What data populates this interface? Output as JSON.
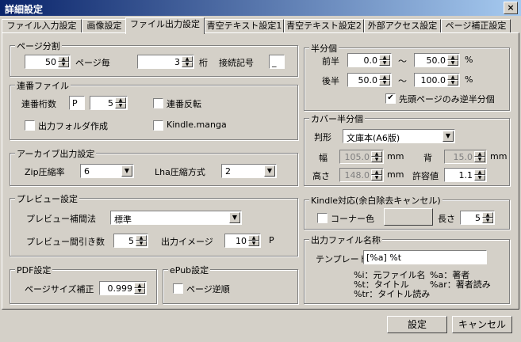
{
  "window": {
    "title": "詳細設定",
    "close_glyph": "×"
  },
  "tabs": [
    {
      "label": "ファイル入力設定"
    },
    {
      "label": "画像設定"
    },
    {
      "label": "ファイル出力設定"
    },
    {
      "label": "青空テキスト設定1"
    },
    {
      "label": "青空テキスト設定2"
    },
    {
      "label": "外部アクセス設定"
    },
    {
      "label": "ページ補正設定"
    }
  ],
  "active_tab": "ファイル出力設定",
  "page_split": {
    "legend": "ページ分割",
    "pages_value": "50",
    "pages_label": "ページ毎",
    "digits_value": "3",
    "digits_label": "桁",
    "suffix_label": "接続記号",
    "suffix_value": "_"
  },
  "serial": {
    "legend": "連番ファイル",
    "digits_label": "連番桁数",
    "prefix_value": "P",
    "digits_value": "5",
    "reverse_label": "連番反転",
    "reverse_checked": false,
    "folder_label": "出力フォルダ作成",
    "folder_checked": false,
    "kindle_label": "Kindle.manga",
    "kindle_checked": false
  },
  "archive": {
    "legend": "アーカイブ出力設定",
    "zip_label": "Zip圧縮率",
    "zip_value": "6",
    "lha_label": "Lha圧縮方式",
    "lha_value": "2"
  },
  "preview": {
    "legend": "プレビュー設定",
    "interp_label": "プレビュー補間法",
    "interp_value": "標準",
    "skip_label": "プレビュー間引き数",
    "skip_value": "5",
    "image_label": "出力イメージ",
    "image_value": "10",
    "image_unit": "P"
  },
  "pdf": {
    "legend": "PDF設定",
    "size_label": "ページサイズ補正",
    "size_value": "0.999"
  },
  "epub": {
    "legend": "ePub設定",
    "reverse_label": "ページ逆順",
    "reverse_checked": false
  },
  "half": {
    "legend": "半分個",
    "first_label": "前半",
    "first_from": "0.0",
    "first_to": "50.0",
    "second_label": "後半",
    "second_from": "50.0",
    "second_to": "100.0",
    "tilde": "～",
    "percent": "%",
    "head_only_label": "先頭ページのみ逆半分個",
    "head_only_checked": true
  },
  "cover": {
    "legend": "カバー半分個",
    "size_label": "判形",
    "size_value": "文庫本(A6版)",
    "width_label": "幅",
    "width_value": "105.0",
    "mm": "mm",
    "spine_label": "背",
    "spine_value": "15.0",
    "height_label": "高さ",
    "height_value": "148.0",
    "tol_label": "許容値",
    "tol_value": "1.1"
  },
  "kindle": {
    "legend": "Kindle対応(余白除去キャンセル)",
    "corner_label": "コーナー色",
    "corner_checked": false,
    "corner_color": "#d4d0c8",
    "length_label": "長さ",
    "length_value": "5"
  },
  "outname": {
    "legend": "出力ファイル名称",
    "template_label": "テンプレート",
    "template_value": "[%a] %t",
    "help": [
      {
        "code": "%i",
        "desc": "元ファイル名"
      },
      {
        "code": "%a",
        "desc": "著者"
      },
      {
        "code": "%t",
        "desc": "タイトル"
      },
      {
        "code": "%ar",
        "desc": "著者読み"
      },
      {
        "code": "%tr",
        "desc": "タイトル読み"
      }
    ]
  },
  "buttons": {
    "ok": "設定",
    "cancel": "キャンセル"
  }
}
